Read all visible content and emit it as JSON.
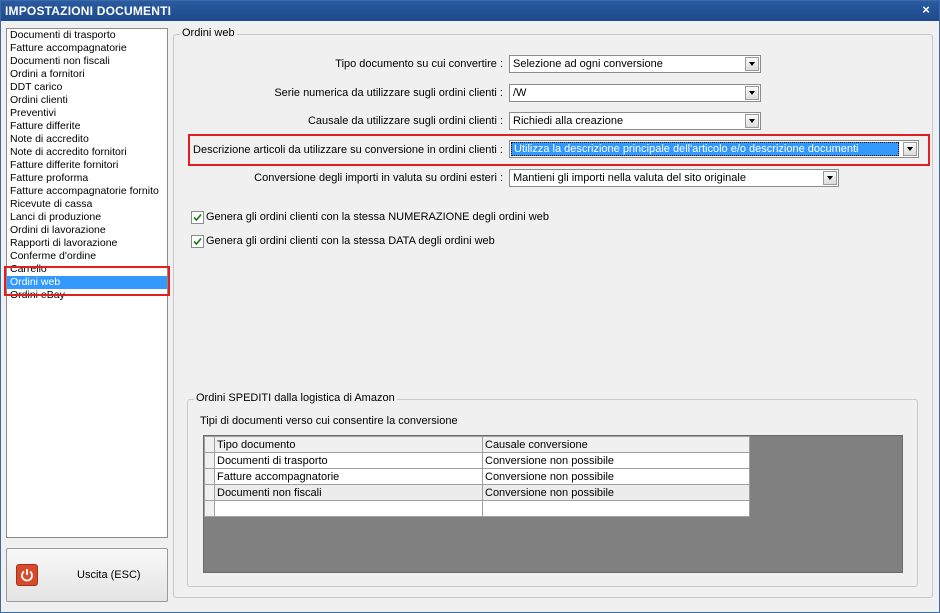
{
  "window": {
    "title": "IMPOSTAZIONI DOCUMENTI",
    "close_glyph": "×"
  },
  "sidebar": {
    "items": [
      "Documenti di trasporto",
      "Fatture accompagnatorie",
      "Documenti non fiscali",
      "Ordini a fornitori",
      "DDT carico",
      "Ordini clienti",
      "Preventivi",
      "Fatture differite",
      "Note di accredito",
      "Note di accredito fornitori",
      "Fatture differite fornitori",
      "Fatture proforma",
      "Fatture accompagnatorie fornito",
      "Ricevute di cassa",
      "Lanci di produzione",
      "Ordini di lavorazione",
      "Rapporti di lavorazione",
      "Conferme d'ordine",
      "Carrello",
      "Ordini web",
      "Ordini eBay"
    ],
    "selected": "Ordini web"
  },
  "exit_button": {
    "label": "Uscita (ESC)",
    "icon": "power-icon"
  },
  "main_group": {
    "title": "Ordini web",
    "fields": [
      {
        "label": "Tipo documento su cui convertire :",
        "value": "Selezione ad ogni conversione"
      },
      {
        "label": "Serie numerica da utilizzare sugli ordini clienti :",
        "value": "/W"
      },
      {
        "label": "Causale da utilizzare sugli ordini clienti :",
        "value": "Richiedi alla creazione"
      },
      {
        "label": "Descrizione articoli da utilizzare su conversione in ordini clienti :",
        "value": "Utilizza la descrizione principale dell'articolo e/o descrizione documenti"
      },
      {
        "label": "Conversione degli importi in valuta su ordini esteri :",
        "value": "Mantieni gli importi nella valuta del sito originale"
      }
    ],
    "checkboxes": [
      {
        "label": "Genera gli ordini clienti con la stessa NUMERAZIONE degli ordini web",
        "checked": true
      },
      {
        "label": "Genera gli ordini clienti con la stessa DATA degli ordini web",
        "checked": true
      }
    ]
  },
  "amazon_group": {
    "title": "Ordini SPEDITI dalla logistica di Amazon",
    "subtitle": "Tipi di documenti verso cui consentire la conversione",
    "columns": [
      "Tipo documento",
      "Causale conversione"
    ],
    "rows": [
      [
        "Documenti di trasporto",
        "Conversione non possibile"
      ],
      [
        "Fatture accompagnatorie",
        "Conversione non possibile"
      ],
      [
        "Documenti non fiscali",
        "Conversione non possibile"
      ]
    ]
  },
  "colors": {
    "titlebar": "#1d4a8c",
    "selection": "#3399ff",
    "highlight_box": "#e02020",
    "exit_icon": "#d84a2c"
  }
}
